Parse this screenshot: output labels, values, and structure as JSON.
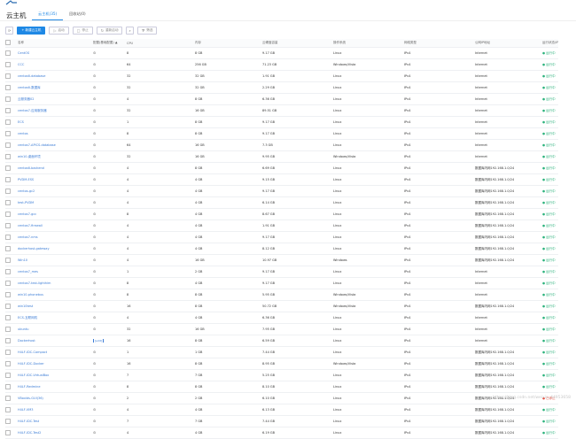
{
  "page": {
    "title": "云主机"
  },
  "tabs": [
    {
      "label": "云主机(35)",
      "active": true
    },
    {
      "label": "回收站(0)",
      "active": false
    }
  ],
  "toolbar": {
    "create_label": "+ 新建云主机",
    "start_label": "启动",
    "stop_label": "停止",
    "restart_label": "重新启动",
    "filter_label": "筛选"
  },
  "table": {
    "columns": [
      "名称",
      "配置(基础配置)",
      "CPU",
      "内存",
      "云硬盘容量",
      "操作系统",
      "网络类型",
      "公网IP地址",
      "运行状态/IP"
    ],
    "sort_indicator": "▲",
    "rows": [
      {
        "name": "CentOS",
        "config": "⚙",
        "cpu": "8",
        "mem": "8 GB",
        "disk": "9.17 GB",
        "os": "Linux",
        "net": "IPv4",
        "pub": "Internet",
        "status": "● 运行中"
      },
      {
        "name": "CCC",
        "config": "⚙",
        "cpu": "64",
        "mem": "256 GB",
        "disk": "71.23 GB",
        "os": "Windows/Vista",
        "net": "IPv4",
        "pub": "Internet",
        "status": "● 运行中"
      },
      {
        "name": "centos6-database",
        "config": "⚙",
        "cpu": "32",
        "mem": "32 GB",
        "disk": "1.91 GB",
        "os": "Linux",
        "net": "IPv4",
        "pub": "Internet",
        "status": "● 运行中"
      },
      {
        "name": "centos6-数据库",
        "config": "⚙",
        "cpu": "32",
        "mem": "32 GB",
        "disk": "2.29 GB",
        "os": "Linux",
        "net": "IPv4",
        "pub": "Internet",
        "status": "● 运行中"
      },
      {
        "name": "云服务器02",
        "config": "⚙",
        "cpu": "4",
        "mem": "8 GB",
        "disk": "6.36 GB",
        "os": "Linux",
        "net": "IPv4",
        "pub": "Internet",
        "status": "● 运行中"
      },
      {
        "name": "centos7-应用服务器",
        "config": "⚙",
        "cpu": "32",
        "mem": "16 GB",
        "disk": "89.51 GB",
        "os": "Linux",
        "net": "IPv4",
        "pub": "Internet",
        "status": "● 运行中"
      },
      {
        "name": "ECS",
        "config": "⚙",
        "cpu": "1",
        "mem": "8 GB",
        "disk": "9.17 GB",
        "os": "Linux",
        "net": "IPv4",
        "pub": "Internet",
        "status": "● 运行中"
      },
      {
        "name": "centos",
        "config": "⚙",
        "cpu": "8",
        "mem": "8 GB",
        "disk": "9.17 GB",
        "os": "Linux",
        "net": "IPv4",
        "pub": "Internet",
        "status": "● 运行中"
      },
      {
        "name": "centos7-APICS-database",
        "config": "⚙",
        "cpu": "64",
        "mem": "16 GB",
        "disk": "7.3 GB",
        "os": "Linux",
        "net": "IPv4",
        "pub": "Internet",
        "status": "● 运行中"
      },
      {
        "name": "win10-桌面环境",
        "config": "⚙",
        "cpu": "32",
        "mem": "16 GB",
        "disk": "9.95 GB",
        "os": "Windows/Vista",
        "net": "IPv4",
        "pub": "Internet",
        "status": "● 运行中"
      },
      {
        "name": "centos6-backend",
        "config": "⚙",
        "cpu": "4",
        "mem": "8 GB",
        "disk": "6.69 GB",
        "os": "Linux",
        "net": "IPv4",
        "pub": "数据库内网192.168.1.0/24",
        "status": "● 运行中"
      },
      {
        "name": "PVDM-ESS",
        "config": "⚙",
        "cpu": "4",
        "mem": "4 GB",
        "disk": "9.15 GB",
        "os": "Linux",
        "net": "IPv4",
        "pub": "数据库内网192.168.1.0/24",
        "status": "● 运行中"
      },
      {
        "name": "centos-gc2",
        "config": "⚙",
        "cpu": "4",
        "mem": "4 GB",
        "disk": "9.17 GB",
        "os": "Linux",
        "net": "IPv4",
        "pub": "数据库内网192.168.1.0/24",
        "status": "● 运行中"
      },
      {
        "name": "test-PVDM",
        "config": "⚙",
        "cpu": "4",
        "mem": "4 GB",
        "disk": "6.14 GB",
        "os": "Linux",
        "net": "IPv4",
        "pub": "数据库内网192.168.1.0/24",
        "status": "● 运行中"
      },
      {
        "name": "centos7-gcc",
        "config": "⚙",
        "cpu": "8",
        "mem": "4 GB",
        "disk": "8.67 GB",
        "os": "Linux",
        "net": "IPv4",
        "pub": "数据库内网192.168.1.0/24",
        "status": "● 运行中"
      },
      {
        "name": "centos7-firewall",
        "config": "⚙",
        "cpu": "4",
        "mem": "4 GB",
        "disk": "1.91 GB",
        "os": "Linux",
        "net": "IPv4",
        "pub": "数据库内网192.168.1.0/24",
        "status": "● 运行中"
      },
      {
        "name": "centos7-nms",
        "config": "⚙",
        "cpu": "4",
        "mem": "4 GB",
        "disk": "9.17 GB",
        "os": "Linux",
        "net": "IPv4",
        "pub": "数据库内网192.168.1.0/24",
        "status": "● 运行中"
      },
      {
        "name": "dockerhost-gateway",
        "config": "⚙",
        "cpu": "4",
        "mem": "4 GB",
        "disk": "8.12 GB",
        "os": "Linux",
        "net": "IPv4",
        "pub": "数据库内网192.168.1.0/24",
        "status": "● 运行中"
      },
      {
        "name": "Win10",
        "config": "⚙",
        "cpu": "4",
        "mem": "16 GB",
        "disk": "10.97 GB",
        "os": "Windows",
        "net": "IPv4",
        "pub": "数据库内网192.168.1.0/24",
        "status": "● 运行中"
      },
      {
        "name": "centos7_mes",
        "config": "⚙",
        "cpu": "1",
        "mem": "2 GB",
        "disk": "9.17 GB",
        "os": "Linux",
        "net": "IPv4",
        "pub": "Internet",
        "status": "● 运行中"
      },
      {
        "name": "centos7-test-lighthim",
        "config": "⚙",
        "cpu": "8",
        "mem": "4 GB",
        "disk": "9.17 GB",
        "os": "Linux",
        "net": "IPv4",
        "pub": "Internet",
        "status": "● 运行中"
      },
      {
        "name": "win10-phonebus",
        "config": "⚙",
        "cpu": "8",
        "mem": "8 GB",
        "disk": "5.95 GB",
        "os": "Windows/Vista",
        "net": "IPv4",
        "pub": "Internet",
        "status": "● 运行中"
      },
      {
        "name": "win10test",
        "config": "⚙",
        "cpu": "16",
        "mem": "8 GB",
        "disk": "50.72 GB",
        "os": "Windows/Vista",
        "net": "IPv4",
        "pub": "数据库内网192.168.1.0/24",
        "status": "● 运行中"
      },
      {
        "name": "ECS-互联网机",
        "config": "⚙",
        "cpu": "4",
        "mem": "4 GB",
        "disk": "6.36 GB",
        "os": "Linux",
        "net": "IPv4",
        "pub": "Internet",
        "status": "● 运行中"
      },
      {
        "name": "ubuntu",
        "config": "⚙",
        "cpu": "32",
        "mem": "16 GB",
        "disk": "7.95 GB",
        "os": "Linux",
        "net": "IPv4",
        "pub": "Internet",
        "status": "● 运行中"
      },
      {
        "name": "Dockerhost",
        "config": "[edit]",
        "cpu": "16",
        "mem": "8 GB",
        "disk": "6.59 GB",
        "os": "Linux",
        "net": "IPv4",
        "pub": "Internet",
        "status": "● 运行中"
      },
      {
        "name": "H4LF-IDC-Compact",
        "config": "⚙",
        "cpu": "1",
        "mem": "1 GB",
        "disk": "7.44 GB",
        "os": "Linux",
        "net": "IPv4",
        "pub": "数据库内网192.168.1.0/24",
        "status": "● 运行中"
      },
      {
        "name": "H4LF-IDC-Docker",
        "config": "⚙",
        "cpu": "16",
        "mem": "8 GB",
        "disk": "8.95 GB",
        "os": "Windows/Vista",
        "net": "IPv4",
        "pub": "数据库内网192.168.1.0/24",
        "status": "● 运行中"
      },
      {
        "name": "H4LF-IDC-VirtualBox",
        "config": "⚙",
        "cpu": "7",
        "mem": "7 GB",
        "disk": "5.25 GB",
        "os": "Linux",
        "net": "IPv4",
        "pub": "数据库内网192.168.1.0/24",
        "status": "● 运行中"
      },
      {
        "name": "H4LF-Redmine",
        "config": "⚙",
        "cpu": "8",
        "mem": "8 GB",
        "disk": "8.10 GB",
        "os": "Linux",
        "net": "IPv4",
        "pub": "数据库内网192.168.1.0/24",
        "status": "● 运行中"
      },
      {
        "name": "VBoxlds-GUI(36)",
        "config": "⚙",
        "cpu": "2",
        "mem": "2 GB",
        "disk": "6.10 GB",
        "os": "Linux",
        "net": "IPv4",
        "pub": "数据库内网192.168.1.0/24",
        "status": "● 已停止"
      },
      {
        "name": "H4LF-VM3",
        "config": "⚙",
        "cpu": "4",
        "mem": "4 GB",
        "disk": "6.13 GB",
        "os": "Linux",
        "net": "IPv4",
        "pub": "数据库内网192.168.1.0/24",
        "status": "● 运行中"
      },
      {
        "name": "H4LF-IDC-Test",
        "config": "⚙",
        "cpu": "7",
        "mem": "7 GB",
        "disk": "7.44 GB",
        "os": "Linux",
        "net": "IPv4",
        "pub": "数据库内网192.168.1.0/24",
        "status": "● 运行中"
      },
      {
        "name": "H4LF-IDC-Test2",
        "config": "⚙",
        "cpu": "4",
        "mem": "4 GB",
        "disk": "6.19 GB",
        "os": "Linux",
        "net": "IPv4",
        "pub": "数据库内网192.168.1.0/24",
        "status": "● 运行中"
      }
    ]
  },
  "watermark": "https://blog.csdn.net/weixin_44953658",
  "colors": {
    "accent": "#1e88e5",
    "running": "#2ab27b",
    "stopped": "#e64a3c",
    "link": "#3a7bd5"
  }
}
